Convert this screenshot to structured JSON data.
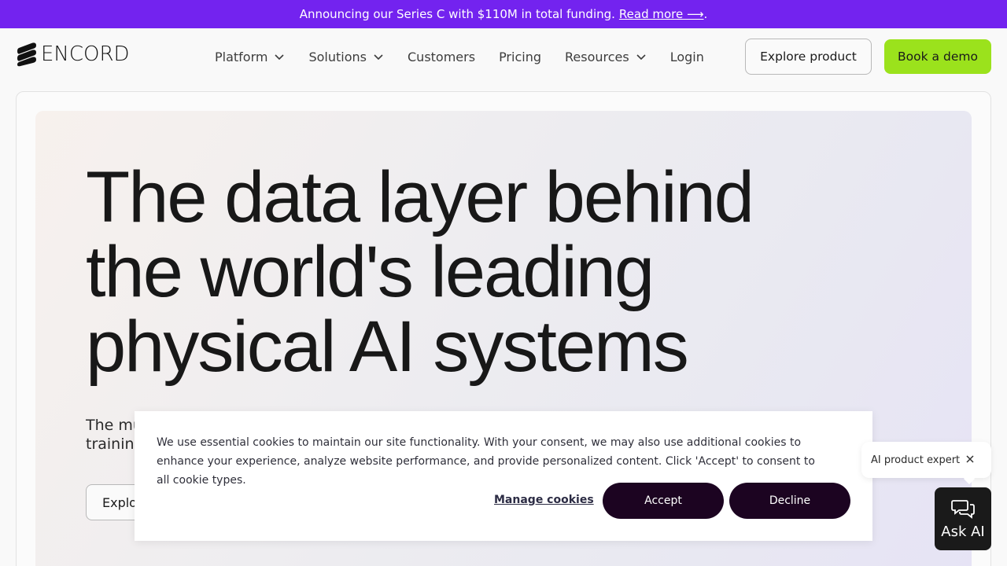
{
  "announcement": {
    "text": "Announcing our Series C with $110M in total funding.",
    "link": "Read more ⟶",
    "trailing": "."
  },
  "brand": {
    "name": "ENCORD",
    "logo_icon": "encord-logo-icon"
  },
  "nav": {
    "items": [
      {
        "label": "Platform",
        "has_dropdown": true
      },
      {
        "label": "Solutions",
        "has_dropdown": true
      },
      {
        "label": "Customers",
        "has_dropdown": false
      },
      {
        "label": "Pricing",
        "has_dropdown": false
      },
      {
        "label": "Resources",
        "has_dropdown": true
      },
      {
        "label": "Login",
        "has_dropdown": false
      }
    ],
    "explore_label": "Explore product",
    "demo_label": "Book a demo"
  },
  "hero": {
    "title_lines": [
      "The data layer behind",
      "the world's leading",
      "physical AI systems"
    ],
    "subtitle_lines": [
      "The mu",
      "training"
    ],
    "explore_label": "Explo"
  },
  "cookie": {
    "text": "We use essential cookies to maintain our site functionality. With your consent, we may also use additional cookies to enhance your experience, analyze website performance, and provide personalized content. Click 'Accept' to consent to all cookie types.",
    "manage_label": "Manage cookies",
    "accept_label": "Accept",
    "decline_label": "Decline"
  },
  "ai_widget": {
    "tooltip": "AI product expert",
    "button_label": "Ask AI",
    "icon": "chat-bubbles-icon"
  },
  "colors": {
    "announcement_bg": "#7323ef",
    "demo_button_bg": "#9be21c",
    "cookie_button_bg": "#1c0421",
    "ask_ai_bg": "#1a1a1a"
  }
}
